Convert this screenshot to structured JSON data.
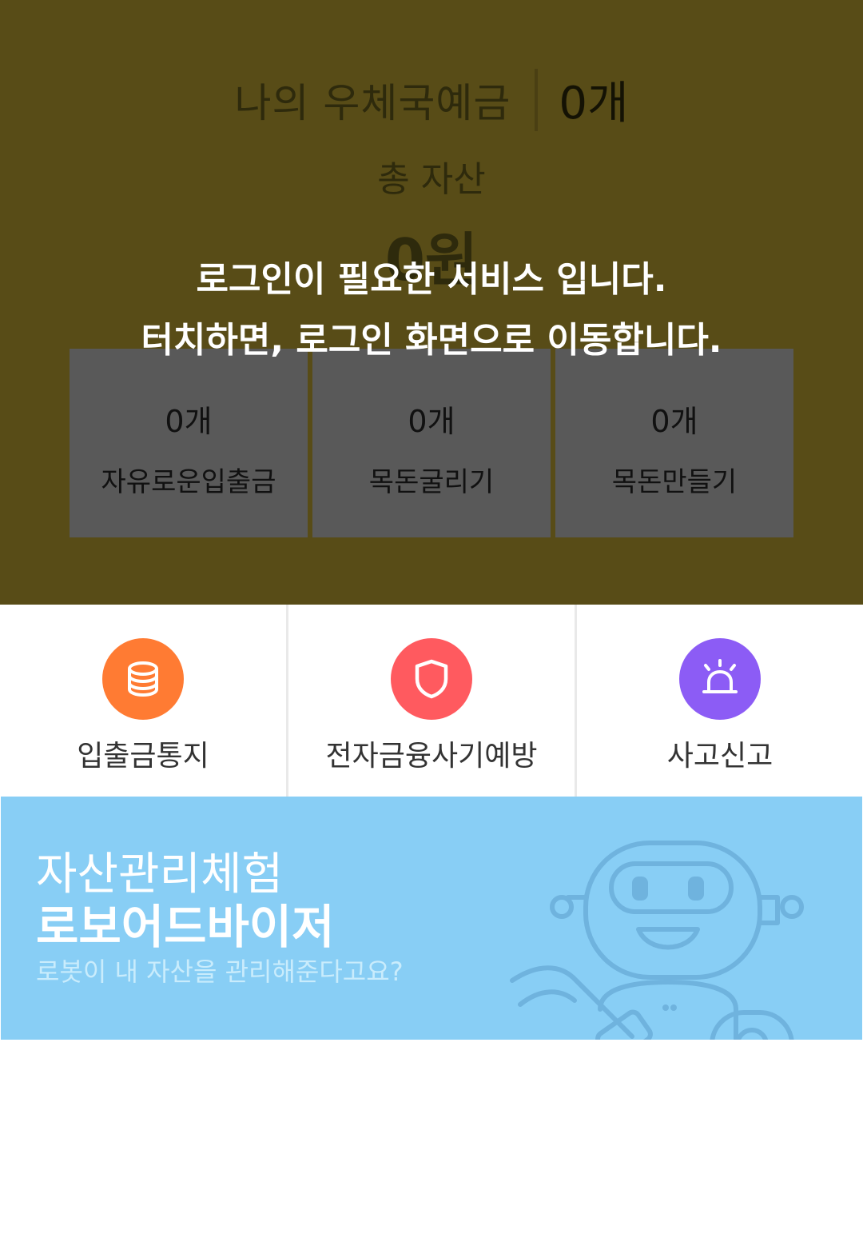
{
  "asset_summary": {
    "bank_name": "나의 우체국예금",
    "account_count": "0개",
    "total_label": "총 자산",
    "total_amount": "0원"
  },
  "login_overlay": {
    "line1": "로그인이 필요한 서비스 입니다.",
    "line2": "터치하면, 로그인 화면으로 이동합니다."
  },
  "products": [
    {
      "count": "0개",
      "label": "자유로운입출금"
    },
    {
      "count": "0개",
      "label": "목돈굴리기"
    },
    {
      "count": "0개",
      "label": "목돈만들기"
    }
  ],
  "quick_menu": [
    {
      "label": "입출금통지",
      "icon": "coin-stack-icon",
      "color": "#ff7b33"
    },
    {
      "label": "전자금융사기예방",
      "icon": "shield-icon",
      "color": "#ff5a5f"
    },
    {
      "label": "사고신고",
      "icon": "siren-icon",
      "color": "#8c5cf5"
    }
  ],
  "banner": {
    "title1": "자산관리체험",
    "title2": "로보어드바이저",
    "subtitle": "로봇이 내 자산을 관리해준다고요?",
    "illustration": "robot-icon",
    "background": "#88cef5"
  }
}
